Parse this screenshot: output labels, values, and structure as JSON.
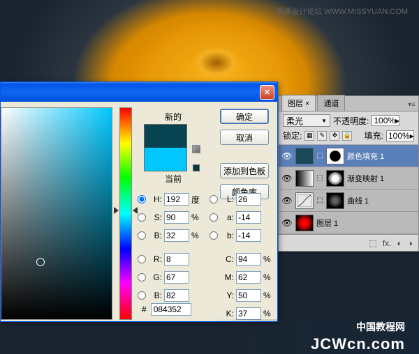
{
  "watermark": {
    "top": "思缘设计论坛  WWW.MISSYUAN.COM",
    "bottom_cn": "中国教程网",
    "bottom_en": "JCWcn.com"
  },
  "color_picker": {
    "new_label": "新的",
    "current_label": "当前",
    "new_color": "#084352",
    "current_color": "#00c8ff",
    "buttons": {
      "ok": "确定",
      "cancel": "取消",
      "add_swatch": "添加到色板",
      "color_lib": "颜色库"
    },
    "hsb": {
      "h": "192",
      "s": "90",
      "b": "32",
      "h_unit": "度",
      "pct": "%"
    },
    "lab": {
      "l": "26",
      "a": "-14",
      "b": "-14"
    },
    "rgb": {
      "r": "8",
      "g": "67",
      "b": "82"
    },
    "cmyk": {
      "c": "94",
      "m": "62",
      "y": "50",
      "k": "37",
      "pct": "%"
    },
    "hex_prefix": "#",
    "hex": "084352",
    "labels": {
      "H": "H:",
      "S": "S:",
      "B": "B:",
      "L": "L:",
      "a": "a:",
      "b": "b:",
      "R": "R:",
      "G": "G:",
      "Bb": "B:",
      "C": "C:",
      "M": "M:",
      "Y": "Y:",
      "K": "K:"
    }
  },
  "layers": {
    "tabs": {
      "layers": "图层 ×",
      "channels": "通道"
    },
    "blend_mode": "柔光",
    "opacity_label": "不透明度:",
    "opacity_value": "100%",
    "lock_label": "锁定:",
    "fill_label": "填充:",
    "fill_value": "100%",
    "items": [
      {
        "label": "颜色填充 1"
      },
      {
        "label": "渐变映射 1"
      },
      {
        "label": "曲线 1"
      },
      {
        "label": "图层 1"
      }
    ],
    "footer_icons": {
      "link": "⬚",
      "fx": "fx.",
      "mask": "◐",
      "adj": "◑",
      "folder": "▭",
      "new": "▫",
      "trash": "🗑"
    }
  }
}
